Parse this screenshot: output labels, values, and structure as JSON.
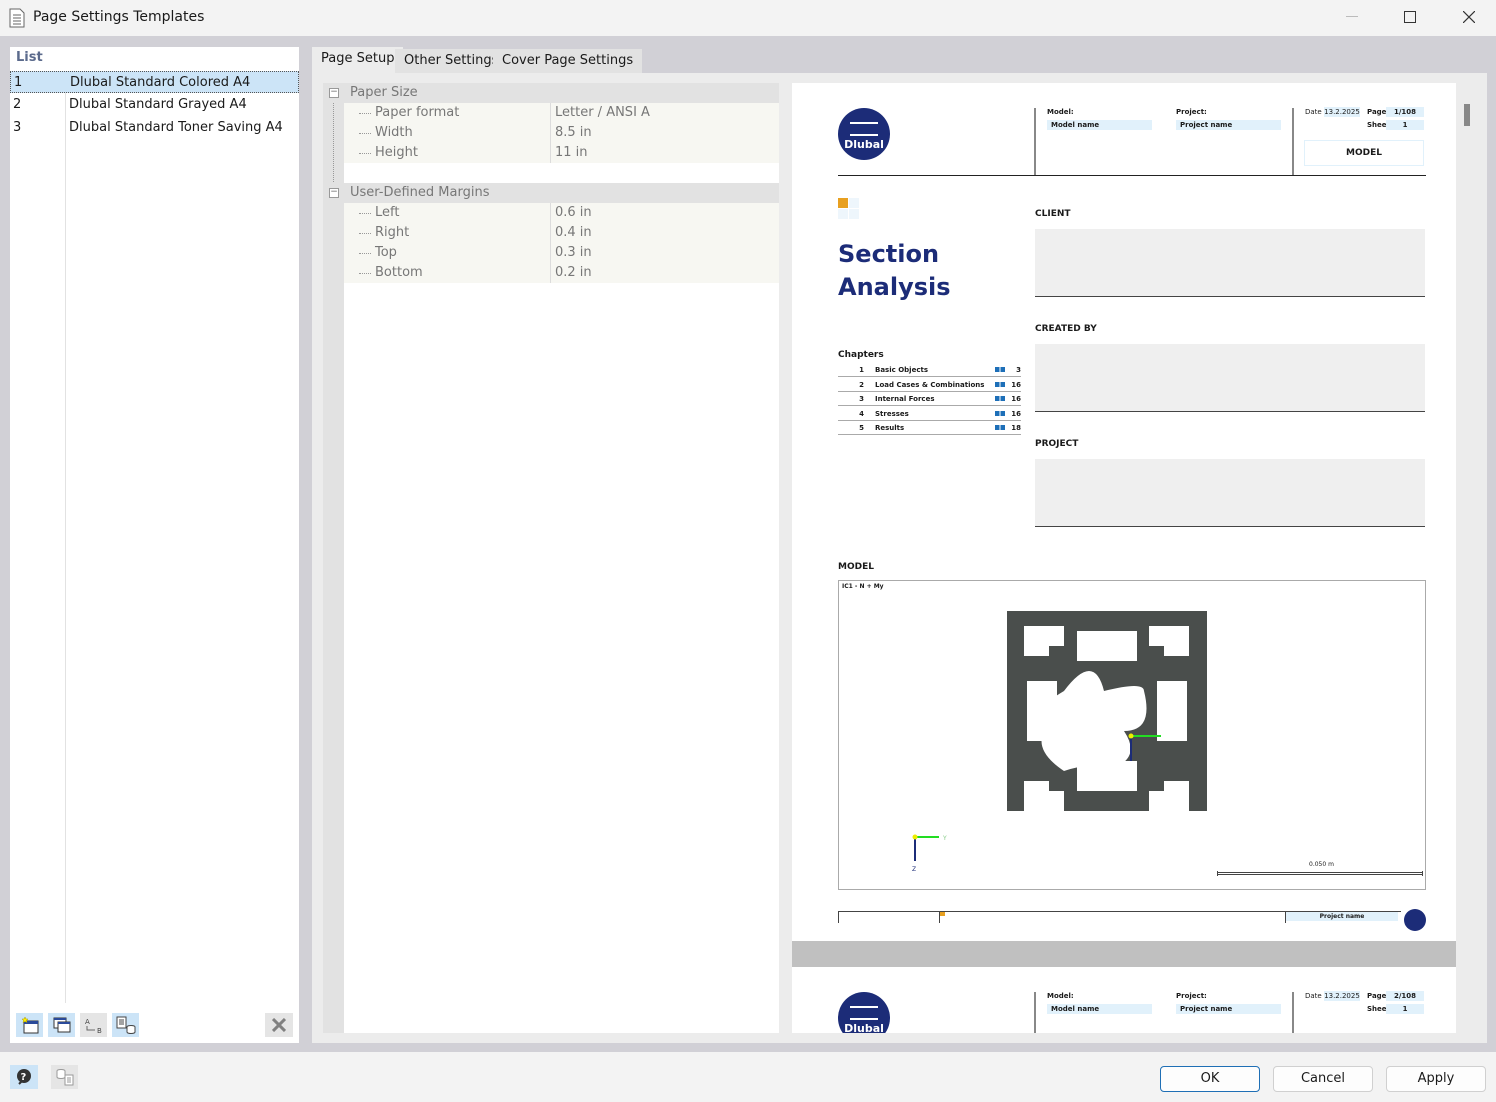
{
  "window": {
    "title": "Page Settings Templates"
  },
  "list": {
    "header": "List",
    "items": [
      {
        "num": "1",
        "name": "Dlubal Standard Colored A4",
        "selected": true
      },
      {
        "num": "2",
        "name": "Dlubal Standard Grayed A4",
        "selected": false
      },
      {
        "num": "3",
        "name": "Dlubal Standard Toner Saving A4",
        "selected": false
      }
    ],
    "tools": [
      {
        "icon": "new-template-icon"
      },
      {
        "icon": "copy-template-icon"
      },
      {
        "icon": "rename-ab-icon"
      },
      {
        "icon": "export-to-database-icon"
      }
    ],
    "delete_icon": "delete-x-icon"
  },
  "tabs": [
    {
      "label": "Page Setup",
      "active": true
    },
    {
      "label": "Other Settings",
      "active": false
    },
    {
      "label": "Cover Page Settings",
      "active": false
    }
  ],
  "page_setup": {
    "groups": [
      {
        "label": "Paper Size",
        "properties": [
          {
            "label": "Paper format",
            "value": "Letter / ANSI A"
          },
          {
            "label": "Width",
            "value": "8.5 in"
          },
          {
            "label": "Height",
            "value": "11 in"
          }
        ]
      },
      {
        "label": "User-Defined Margins",
        "properties": [
          {
            "label": "Left",
            "value": "0.6 in"
          },
          {
            "label": "Right",
            "value": "0.4 in"
          },
          {
            "label": "Top",
            "value": "0.3 in"
          },
          {
            "label": "Bottom",
            "value": "0.2 in"
          }
        ]
      }
    ]
  },
  "preview": {
    "logo_text": "Dlubal",
    "header": {
      "model_label": "Model:",
      "model_value": "Model name",
      "project_label": "Project:",
      "project_value": "Project name",
      "date_label": "Date",
      "date_value": "13.2.2025",
      "page_label": "Page",
      "page_value": "1/108",
      "sheet_label": "Sheet",
      "sheet_value": "1",
      "section_title": "MODEL"
    },
    "cover_title_line1": "Section",
    "cover_title_line2": "Analysis",
    "client_label": "CLIENT",
    "created_by_label": "CREATED BY",
    "project_section_label": "PROJECT",
    "chapters_title": "Chapters",
    "chapters": [
      {
        "num": "1",
        "name": "Basic Objects",
        "pages": "3"
      },
      {
        "num": "2",
        "name": "Load Cases & Combinations",
        "pages": "16"
      },
      {
        "num": "3",
        "name": "Internal Forces",
        "pages": "16"
      },
      {
        "num": "4",
        "name": "Stresses",
        "pages": "16"
      },
      {
        "num": "5",
        "name": "Results",
        "pages": "18"
      }
    ],
    "model_section_label": "MODEL",
    "load_case_label": "IC1 - N + My",
    "axis_y": "Y",
    "axis_z": "Z",
    "scale_label": "0.050 m",
    "footer_project": "Project name",
    "page2_header": {
      "model_label": "Model:",
      "model_value": "Model name",
      "project_label": "Project:",
      "project_value": "Project name",
      "date_label": "Date",
      "date_value": "13.2.2025",
      "page_label": "Page",
      "page_value": "2/108",
      "sheet_label": "Sheet",
      "sheet_value": "1"
    },
    "colors": {
      "brand_navy": "#1c2c78",
      "accent_orange": "#e8a020",
      "field_blue": "#e1f1fb"
    }
  },
  "buttons": {
    "ok": "OK",
    "cancel": "Cancel",
    "apply": "Apply"
  }
}
